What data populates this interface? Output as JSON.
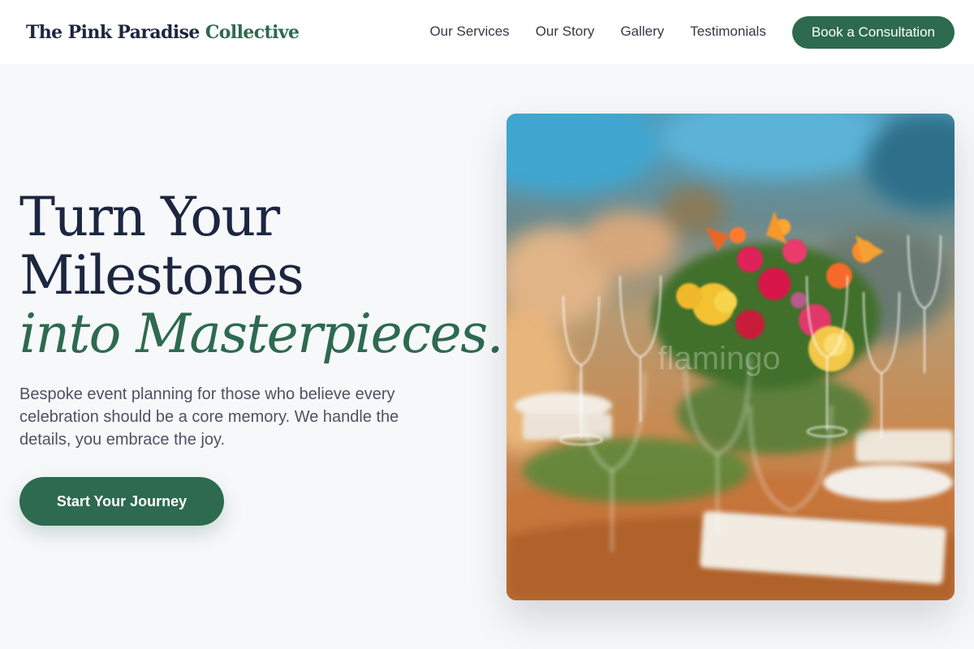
{
  "header": {
    "brand_main": "The Pink Paradise",
    "brand_accent": "Collective",
    "nav": [
      {
        "label": "Our Services"
      },
      {
        "label": "Our Story"
      },
      {
        "label": "Gallery"
      },
      {
        "label": "Testimonials"
      }
    ],
    "cta_label": "Book a Consultation"
  },
  "hero": {
    "title_line1": "Turn Your",
    "title_line2": "Milestones",
    "title_line3": "into Masterpieces.",
    "subtitle": "Bespoke event planning for those who believe every celebration should be a core memory. We handle the details, you embrace the joy.",
    "button_label": "Start Your Journey",
    "image_watermark": "flamingo"
  },
  "colors": {
    "accent": "#2d6a4f",
    "text_dark": "#1c2640",
    "background": "#f7f8fa"
  }
}
